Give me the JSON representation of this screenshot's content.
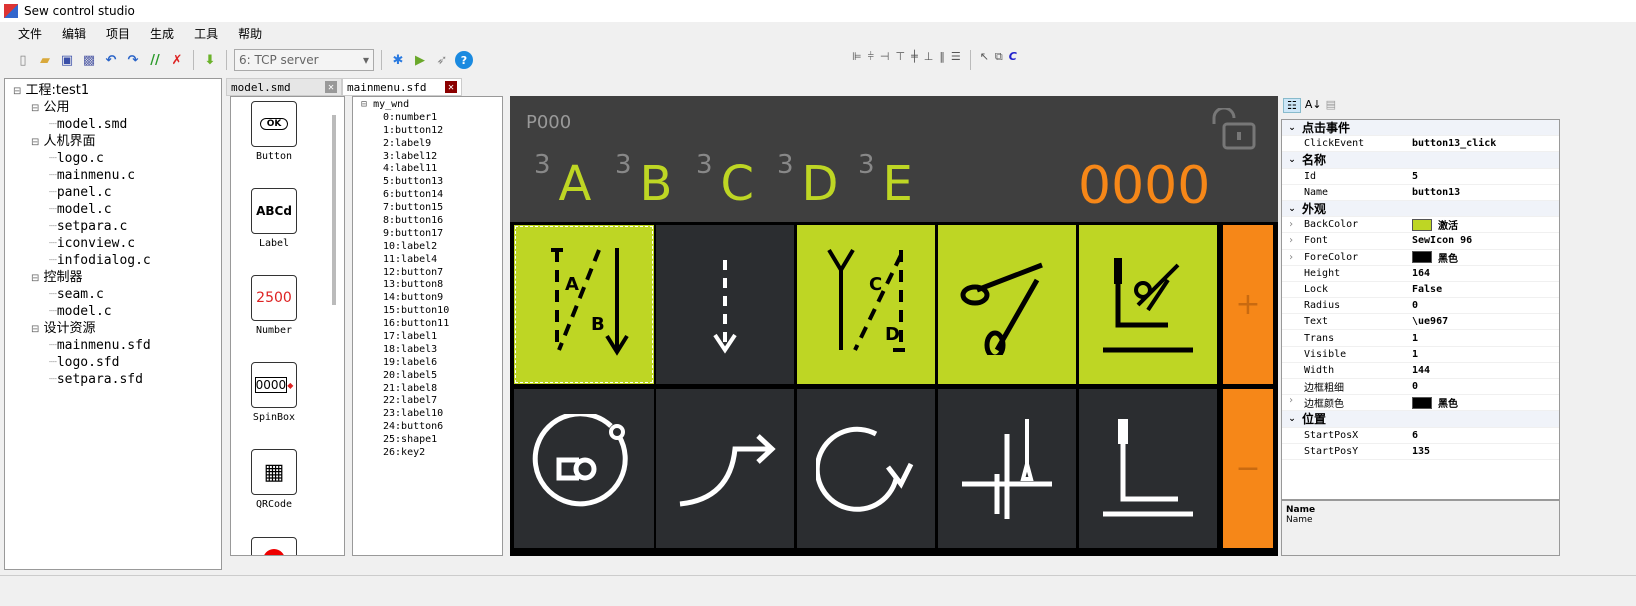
{
  "window": {
    "title": "Sew control studio"
  },
  "menu": [
    "文件",
    "编辑",
    "项目",
    "生成",
    "工具",
    "帮助"
  ],
  "toolbar": {
    "connection": "6: TCP server",
    "icons": [
      "new-file",
      "open-folder",
      "save",
      "save-all",
      "undo",
      "redo",
      "comment",
      "uncomment",
      "download",
      "bluetooth",
      "run",
      "deploy",
      "help"
    ],
    "align_icons": [
      "align-left",
      "align-center",
      "align-right",
      "align-top",
      "align-middle",
      "align-bottom",
      "distribute-h",
      "distribute-v",
      "pointer",
      "tab-order",
      "refresh"
    ]
  },
  "tabs": [
    {
      "label": "model.smd"
    },
    {
      "label": "mainmenu.sfd"
    }
  ],
  "project_tree": [
    {
      "label": "工程:test1",
      "level": 0
    },
    {
      "label": "公用",
      "level": 1
    },
    {
      "label": "model.smd",
      "level": 2
    },
    {
      "label": "人机界面",
      "level": 1
    },
    {
      "label": "logo.c",
      "level": 2
    },
    {
      "label": "mainmenu.c",
      "level": 2
    },
    {
      "label": "panel.c",
      "level": 2
    },
    {
      "label": "model.c",
      "level": 2
    },
    {
      "label": "setpara.c",
      "level": 2
    },
    {
      "label": "iconview.c",
      "level": 2
    },
    {
      "label": "infodialog.c",
      "level": 2
    },
    {
      "label": "控制器",
      "level": 1
    },
    {
      "label": "seam.c",
      "level": 2
    },
    {
      "label": "model.c",
      "level": 2
    },
    {
      "label": "设计资源",
      "level": 1
    },
    {
      "label": "mainmenu.sfd",
      "level": 2
    },
    {
      "label": "logo.sfd",
      "level": 2
    },
    {
      "label": "setpara.sfd",
      "level": 2
    }
  ],
  "widgets": [
    {
      "label": "Button",
      "icon_text": "OK"
    },
    {
      "label": "Label",
      "icon_text": "ABCd"
    },
    {
      "label": "Number",
      "icon_text": "2500"
    },
    {
      "label": "SpinBox",
      "icon_text": "0000"
    },
    {
      "label": "QRCode",
      "icon_text": ""
    }
  ],
  "object_tree": {
    "root": "my_wnd",
    "items": [
      "0:number1",
      "1:button12",
      "2:label9",
      "3:label12",
      "4:label11",
      "5:button13",
      "6:button14",
      "7:button15",
      "8:button16",
      "9:button17",
      "10:label2",
      "11:label4",
      "12:button7",
      "13:button8",
      "14:button9",
      "15:button10",
      "16:button11",
      "17:label1",
      "18:label3",
      "19:label6",
      "20:label5",
      "21:label8",
      "22:label7",
      "23:label10",
      "24:button6",
      "25:shape1",
      "26:key2"
    ]
  },
  "canvas": {
    "page": "P000",
    "counter": "0000",
    "letters": [
      {
        "sup": "3",
        "letter": "A"
      },
      {
        "sup": "3",
        "letter": "B"
      },
      {
        "sup": "3",
        "letter": "C"
      },
      {
        "sup": "3",
        "letter": "D"
      },
      {
        "sup": "3",
        "letter": "E"
      }
    ],
    "plus": "+",
    "minus": "−",
    "colors": {
      "green": "#bed624",
      "dark": "#2b2d30",
      "orange": "#f68718",
      "header": "#3f3f3f",
      "counter": "#f68718"
    }
  },
  "properties": [
    {
      "category": "点击事件",
      "rows": [
        {
          "key": "ClickEvent",
          "value": "button13_click"
        }
      ]
    },
    {
      "category": "名称",
      "rows": [
        {
          "key": "Id",
          "value": "5"
        },
        {
          "key": "Name",
          "value": "button13"
        }
      ]
    },
    {
      "category": "外观",
      "rows": [
        {
          "key": "BackColor",
          "value": "激活",
          "swatch": "#bed624",
          "expand": true
        },
        {
          "key": "Font",
          "value": "SewIcon 96",
          "expand": true
        },
        {
          "key": "ForeColor",
          "value": "黑色",
          "swatch": "#000000",
          "expand": true
        },
        {
          "key": "Height",
          "value": "164"
        },
        {
          "key": "Lock",
          "value": "False"
        },
        {
          "key": "Radius",
          "value": "0"
        },
        {
          "key": "Text",
          "value": "\\ue967"
        },
        {
          "key": "Trans",
          "value": "1"
        },
        {
          "key": "Visible",
          "value": "1"
        },
        {
          "key": "Width",
          "value": "144"
        },
        {
          "key": "边框粗细",
          "value": "0"
        },
        {
          "key": "边框颜色",
          "value": "黑色",
          "swatch": "#000000",
          "expand": true
        }
      ]
    },
    {
      "category": "位置",
      "rows": [
        {
          "key": "StartPosX",
          "value": "6"
        },
        {
          "key": "StartPosY",
          "value": "135"
        }
      ]
    }
  ],
  "description": {
    "title": "Name",
    "text": "Name"
  }
}
